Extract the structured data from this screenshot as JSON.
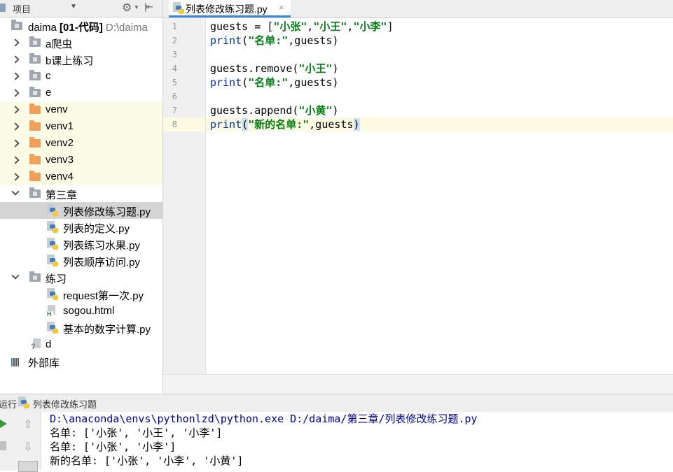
{
  "project_panel": {
    "title": "项目",
    "tree": [
      {
        "label": "daima",
        "bold_label": "[01-代码]",
        "path": "D:\\daima",
        "kind": "folder",
        "expanded": true
      },
      {
        "label": "a爬虫",
        "kind": "folder"
      },
      {
        "label": "b课上练习",
        "kind": "folder"
      },
      {
        "label": "c",
        "kind": "folder"
      },
      {
        "label": "e",
        "kind": "folder"
      },
      {
        "label": "venv",
        "kind": "venv-folder"
      },
      {
        "label": "venv1",
        "kind": "venv-folder"
      },
      {
        "label": "venv2",
        "kind": "venv-folder"
      },
      {
        "label": "venv3",
        "kind": "venv-folder"
      },
      {
        "label": "venv4",
        "kind": "venv-folder"
      },
      {
        "label": "第三章",
        "kind": "folder",
        "expanded": true
      },
      {
        "label": "列表修改练习题.py",
        "kind": "python-file",
        "selected": true
      },
      {
        "label": "列表的定义.py",
        "kind": "python-file"
      },
      {
        "label": "列表练习水果.py",
        "kind": "python-file"
      },
      {
        "label": "列表顺序访问.py",
        "kind": "python-file"
      },
      {
        "label": "练习",
        "kind": "folder",
        "expanded": true
      },
      {
        "label": "request第一次.py",
        "kind": "python-file"
      },
      {
        "label": "sogou.html",
        "kind": "html-file"
      },
      {
        "label": "基本的数字计算.py",
        "kind": "python-file"
      },
      {
        "label": "d",
        "kind": "unknown-file"
      },
      {
        "label": "外部库",
        "kind": "library"
      }
    ]
  },
  "editor": {
    "tab_label": "列表修改练习题.py",
    "close_glyph": "×",
    "line_numbers": [
      "1",
      "2",
      "3",
      "4",
      "5",
      "6",
      "7",
      "8"
    ],
    "lines": {
      "l1": {
        "a": "guests = [",
        "s1": "\"小张\"",
        "c1": ",",
        "s2": "\"小王\"",
        "c2": ",",
        "s3": "\"小李\"",
        "b": "]"
      },
      "l2": {
        "fn": "print",
        "p1": "(",
        "s": "\"名单:\"",
        "rest": ",guests)"
      },
      "l4": {
        "a": "guests.remove(",
        "s": "\"小王\"",
        "b": ")"
      },
      "l5": {
        "fn": "print",
        "p1": "(",
        "s": "\"名单:\"",
        "rest": ",guests)"
      },
      "l7": {
        "a": "guests.append(",
        "s": "\"小黄\"",
        "b": ")"
      },
      "l8": {
        "fn": "print",
        "p1": "(",
        "s": "\"新的名单:\"",
        "mid": ",guests",
        "p2": ")"
      }
    },
    "current_line": 8
  },
  "run_panel": {
    "title": "运行",
    "config_name": "列表修改练习题",
    "output": [
      "D:\\anaconda\\envs\\pythonlzd\\python.exe D:/daima/第三章/列表修改练习题.py",
      "名单: ['小张', '小王', '小李']",
      "名单: ['小张', '小李']",
      "新的名单: ['小张', '小李', '小黄']"
    ]
  },
  "colors": {
    "string": "#067d17",
    "keyword": "#0033b3",
    "current_line": "#fcfae2",
    "venv_highlight": "#fbfbe6",
    "selection": "#d4d4d4",
    "tab_underline": "#3a86d8"
  },
  "icons": [
    "project-icon",
    "dropdown-caret-icon",
    "gear-icon",
    "hide-panel-icon",
    "folder-icon",
    "python-file-icon",
    "html-file-icon",
    "library-icon",
    "run-icon",
    "stop-icon",
    "scroll-up-icon",
    "scroll-down-icon",
    "soft-wrap-icon"
  ]
}
